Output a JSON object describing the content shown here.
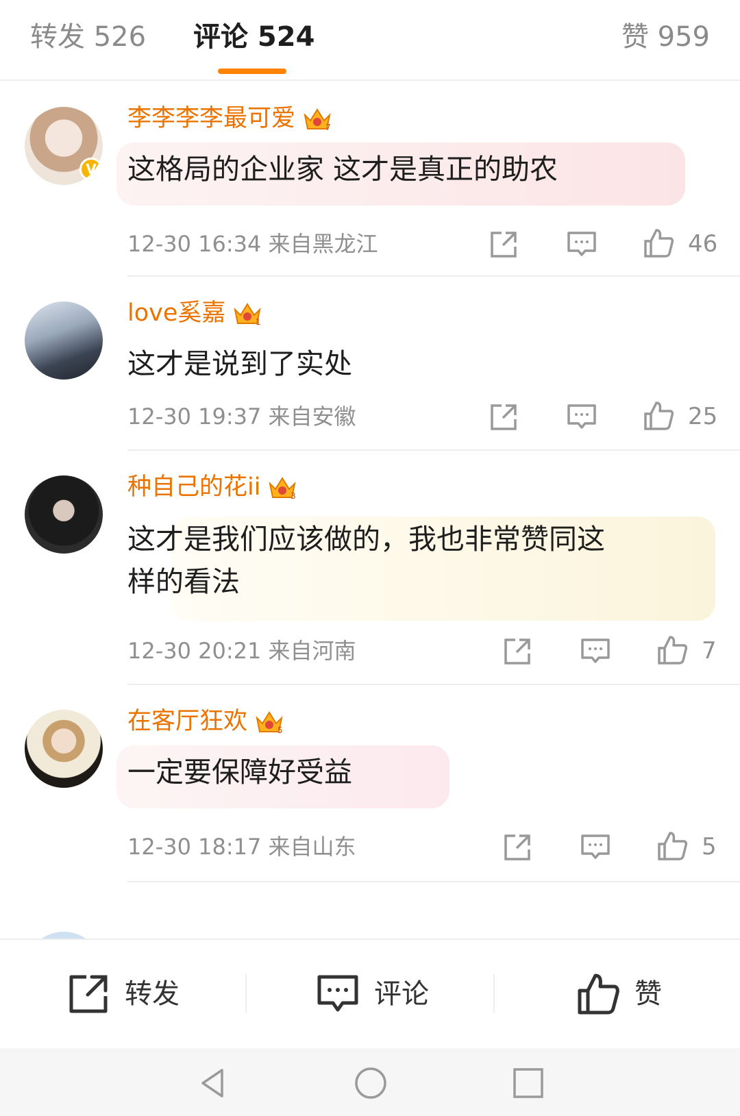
{
  "tabs": {
    "repost": "转发 526",
    "comment": "评论 524",
    "like": "赞 959"
  },
  "comments": [
    {
      "username": "李李李李最可爱",
      "text": "这格局的企业家 这才是真正的助农",
      "time": "12-30 16:34",
      "location": "来自黑龙江",
      "likes": "46",
      "crown_level": "7"
    },
    {
      "username": "love奚嘉",
      "text": "这才是说到了实处",
      "time": "12-30 19:37",
      "location": "来自安徽",
      "likes": "25",
      "crown_level": "1"
    },
    {
      "username": "种自己的花ii",
      "text_line1": "这才是我们应该做的，我也非常赞同这",
      "text_line2": "样的看法",
      "time": "12-30 20:21",
      "location": "来自河南",
      "likes": "7",
      "crown_level": "3"
    },
    {
      "username": "在客厅狂欢",
      "text": "一定要保障好受益",
      "time": "12-30 18:17",
      "location": "来自山东",
      "likes": "5",
      "crown_level": "5"
    }
  ],
  "bottom_bar": {
    "repost": "转发",
    "comment": "评论",
    "like": "赞"
  },
  "colors": {
    "accent": "#ff8200",
    "username": "#eb7300",
    "meta": "#8f8f8f"
  }
}
